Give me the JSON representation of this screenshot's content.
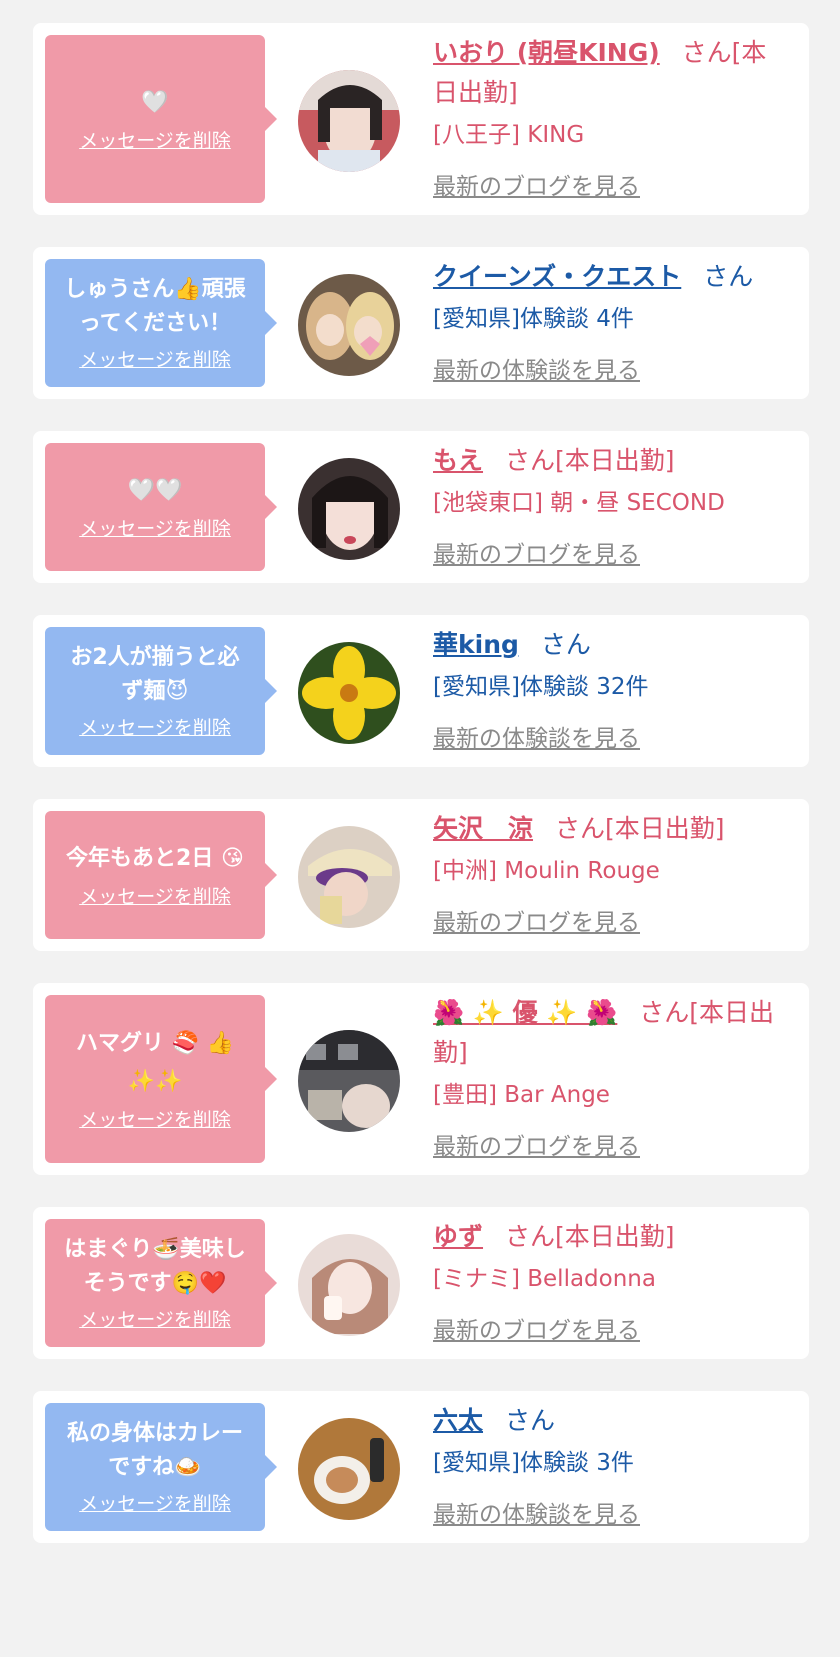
{
  "colors": {
    "pink_bubble": "#f09aa8",
    "blue_bubble": "#93b8f1",
    "pink_text": "#d9546c",
    "blue_text": "#1c5aa6",
    "link_gray": "#8a8a8a"
  },
  "delete_label": "メッセージを削除",
  "items": [
    {
      "theme": "pink",
      "message": "🤍",
      "delete_label": "メッセージを削除",
      "name": "いおり (朝昼KING)",
      "suffix": "さん[本日出勤]",
      "sub": "[八王子] KING",
      "link": "最新のブログを見る",
      "avatar": "photo-girl-1"
    },
    {
      "theme": "blue",
      "message": "しゅうさん👍頑張ってください！",
      "delete_label": "メッセージを削除",
      "name": "クイーンズ・クエスト",
      "suffix": "さん",
      "sub": "[愛知県]体験談 4件",
      "link": "最新の体験談を見る",
      "avatar": "anime-girls"
    },
    {
      "theme": "pink",
      "message": "🤍🤍",
      "delete_label": "メッセージを削除",
      "name": "もえ",
      "suffix": "さん[本日出勤]",
      "sub": "[池袋東口] 朝・昼 SECOND",
      "link": "最新のブログを見る",
      "avatar": "photo-girl-2"
    },
    {
      "theme": "blue",
      "message": "お2人が揃うと必ず麺😈",
      "delete_label": "メッセージを削除",
      "name": "華king",
      "suffix": "さん",
      "sub": "[愛知県]体験談 32件",
      "link": "最新の体験談を見る",
      "avatar": "yellow-flower"
    },
    {
      "theme": "pink",
      "message": "今年もあと2日 😘",
      "delete_label": "メッセージを削除",
      "name": "矢沢　涼",
      "suffix": "さん[本日出勤]",
      "sub": "[中洲] Moulin Rouge",
      "link": "最新のブログを見る",
      "avatar": "photo-girl-3"
    },
    {
      "theme": "pink",
      "message": "ハマグリ 🍣 👍 ✨✨",
      "delete_label": "メッセージを削除",
      "name": "🌺 ✨ 優 ✨ 🌺",
      "suffix": "さん[本日出勤]",
      "sub": "[豊田] Bar Ange",
      "link": "最新のブログを見る",
      "avatar": "photo-girl-4"
    },
    {
      "theme": "pink",
      "message": "はまぐり🍜美味しそうです🤤❤️",
      "delete_label": "メッセージを削除",
      "name": "ゆず",
      "suffix": "さん[本日出勤]",
      "sub": "[ミナミ] Belladonna",
      "link": "最新のブログを見る",
      "avatar": "photo-girl-5"
    },
    {
      "theme": "blue",
      "message": "私の身体はカレーですね🍛",
      "delete_label": "メッセージを削除",
      "name": "六太",
      "suffix": "さん",
      "sub": "[愛知県]体験談 3件",
      "link": "最新の体験談を見る",
      "avatar": "food-plate"
    }
  ]
}
